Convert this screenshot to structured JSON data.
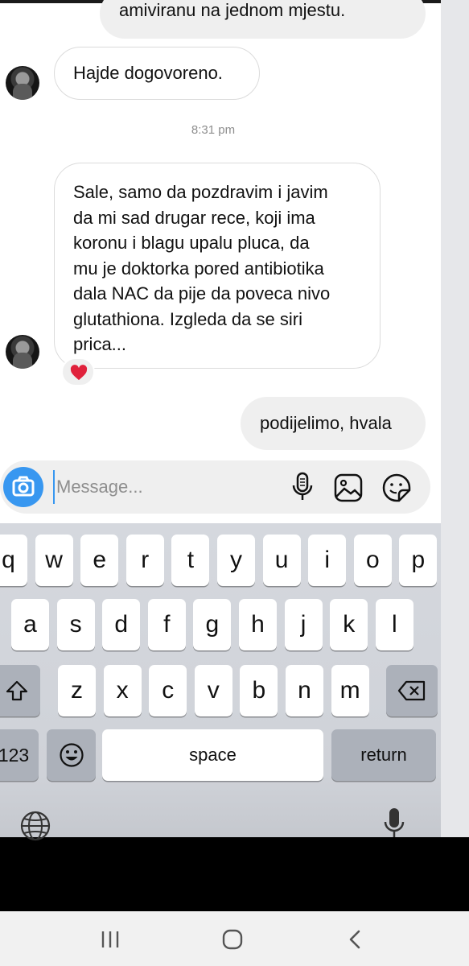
{
  "messages": [
    {
      "direction": "out",
      "text": "amiviranu na jednom mjestu."
    },
    {
      "direction": "in",
      "text": "Hajde dogovoreno."
    },
    {
      "direction": "in",
      "lines": [
        "Sale, samo da pozdravim i javim",
        "da mi sad drugar rece, koji ima",
        "koronu i blagu upalu pluca, da",
        "mu je doktorka pored antibiotika",
        "dala NAC da pije da poveca nivo",
        "glutathiona. Izgleda da se siri",
        "prica..."
      ],
      "reaction": "red-heart"
    },
    {
      "direction": "out",
      "text": "podijelimo, hvala"
    }
  ],
  "timestamp": "8:31 pm",
  "composer": {
    "placeholder": "Message...",
    "icons": [
      "camera-icon",
      "microphone-icon",
      "gallery-icon",
      "sticker-icon"
    ],
    "accent": "#3897f0"
  },
  "keyboard": {
    "row1": [
      "q",
      "w",
      "e",
      "r",
      "t",
      "y",
      "u",
      "i",
      "o",
      "p"
    ],
    "row2": [
      "a",
      "s",
      "d",
      "f",
      "g",
      "h",
      "j",
      "k",
      "l"
    ],
    "row3": [
      "z",
      "x",
      "c",
      "v",
      "b",
      "n",
      "m"
    ],
    "numbers": "123",
    "space": "space",
    "return": "return",
    "icons": [
      "shift-icon",
      "backspace-icon",
      "emoji-icon",
      "globe-icon",
      "dictation-icon"
    ]
  },
  "nav_bar": {
    "icons": [
      "recent-apps-icon",
      "home-icon",
      "back-icon"
    ]
  }
}
